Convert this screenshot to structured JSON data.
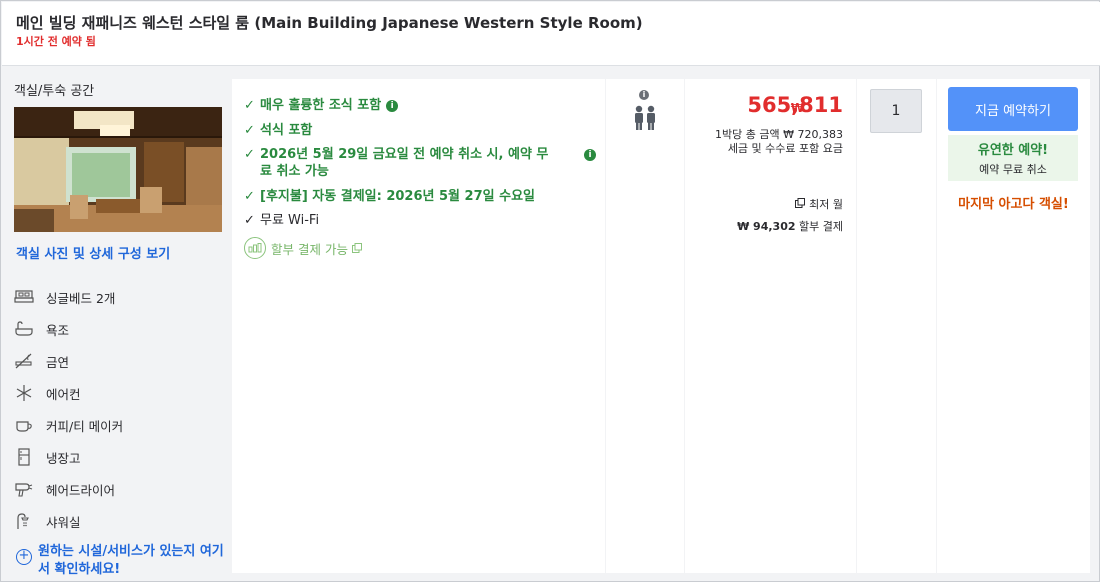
{
  "header": {
    "title": "메인 빌딩 재패니즈 웨스턴 스타일 룸 (Main Building Japanese Western Style Room)",
    "urgency": "1시간 전 예약 됨"
  },
  "room_panel": {
    "section_label": "객실/투숙 공간",
    "photo_link": "객실 사진 및 상세 구성 보기",
    "amenities": [
      {
        "icon": "bed-icon",
        "label": "싱글베드 2개"
      },
      {
        "icon": "bathtub-icon",
        "label": "욕조"
      },
      {
        "icon": "no-smoking-icon",
        "label": "금연"
      },
      {
        "icon": "snowflake-icon",
        "label": "에어컨"
      },
      {
        "icon": "coffee-cup-icon",
        "label": "커피/티 메이커"
      },
      {
        "icon": "refrigerator-icon",
        "label": "냉장고"
      },
      {
        "icon": "hairdryer-icon",
        "label": "헤어드라이어"
      },
      {
        "icon": "shower-icon",
        "label": "샤워실"
      }
    ],
    "facility_link": "원하는 시설/서비스가 있는지 여기서 확인하세요!"
  },
  "benefits": {
    "items": [
      {
        "text": "매우 훌륭한 조식 포함"
      },
      {
        "text": "석식 포함"
      },
      {
        "text_line1": "2026년 5월 29일 금요일 전 예약 취소 시, 예약 무",
        "text_line2": "료 취소 가능"
      },
      {
        "text": "[후지불] 자동 결제일: 2026년 5월 27일 수요일"
      },
      {
        "text": "무료 Wi-Fi"
      }
    ],
    "installment": "할부 결제 가능"
  },
  "occupancy": {
    "info_icon": "info-icon",
    "people_icon": "two-people-icon"
  },
  "price": {
    "currency_symbol": "₩",
    "amount": "565,811",
    "line1": "1박당 총 금액 ₩ 720,383",
    "line2": "세금 및 수수료 포함 요금",
    "lowest_monthly": "최저 월",
    "monthly_amount": "₩ 94,302",
    "monthly_suffix": "할부 결제"
  },
  "quantity": {
    "value": "1"
  },
  "booking": {
    "button_label": "지금 예약하기",
    "flex_title": "유연한 예약!",
    "flex_sub": "예약 무료 취소",
    "last_room": "마지막 아고다 객실!"
  },
  "colors": {
    "accent_blue": "#5392f9",
    "link_blue": "#2067da",
    "price_red": "#e12d2d",
    "benefit_green": "#2a8a3f",
    "last_room_orange": "#d64e00"
  }
}
